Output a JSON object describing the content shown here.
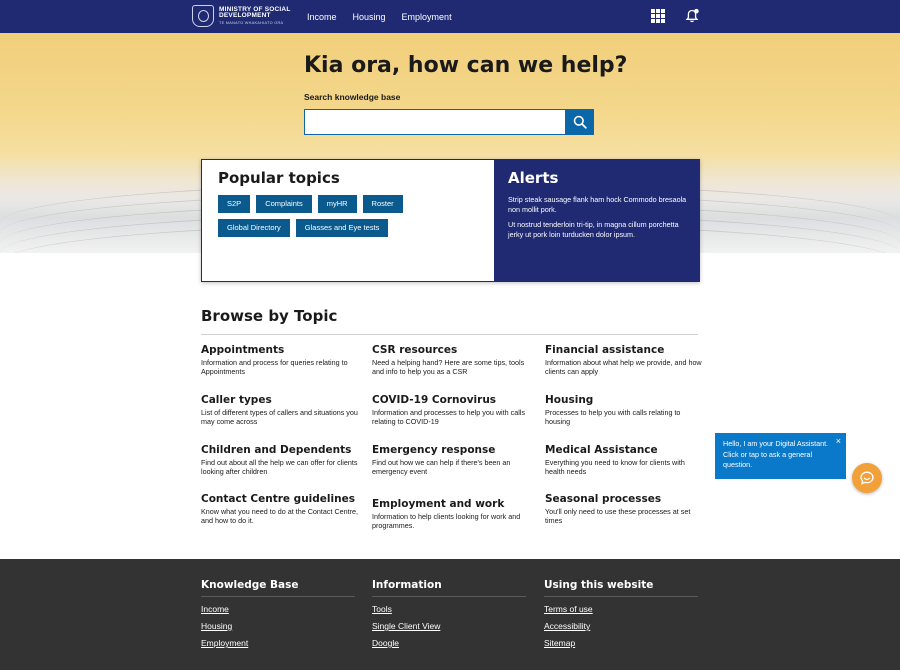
{
  "header": {
    "logo": {
      "line1": "MINISTRY OF SOCIAL",
      "line2": "DEVELOPMENT",
      "line3": "TE MANATŪ WHAKAHIATO ORA"
    },
    "nav": [
      "Income",
      "Housing",
      "Employment"
    ],
    "icons": [
      "apps-grid-icon",
      "notification-bell-icon"
    ]
  },
  "hero": {
    "title": "Kia ora, how can we help?",
    "search_label": "Search knowledge base",
    "search_value": "",
    "search_placeholder": ""
  },
  "popular_topics": {
    "title": "Popular topics",
    "rows": [
      [
        "S2P",
        "Complaints",
        "myHR",
        "Roster"
      ],
      [
        "Global Directory",
        "Glasses and Eye tests"
      ]
    ]
  },
  "alerts": {
    "title": "Alerts",
    "paragraphs": [
      "Strip steak sausage flank ham hock Commodo bresaola non mollit pork.",
      "Ut nostrud tenderloin tri-tip, in magna cillum porchetta jerky ut pork loin turducken dolor ipsum."
    ]
  },
  "browse": {
    "title": "Browse by Topic",
    "topics": [
      {
        "title": "Appointments",
        "desc": "Information and process for queries relating to Appointments"
      },
      {
        "title": "CSR resources",
        "desc": "Need a helping hand? Here are some tips, tools and info to help you as a CSR"
      },
      {
        "title": "Financial assistance",
        "desc": "Information about what help we provide, and how clients can apply"
      },
      {
        "title": "Caller types",
        "desc": "List of different types of callers and situations you may come across"
      },
      {
        "title": "COVID-19 Cornovirus",
        "desc": "Information and processes to help you with calls relating to COVID-19"
      },
      {
        "title": "Housing",
        "desc": "Processes to help you with calls relating to housing"
      },
      {
        "title": "Children and Dependents",
        "desc": "Find out about all the help we can offer for clients looking after children"
      },
      {
        "title": "Emergency response",
        "desc": "Find out how we can help if there's been an emergency event"
      },
      {
        "title": "Medical Assistance",
        "desc": "Everything you need to know for clients with health needs"
      },
      {
        "title": "Contact Centre guidelines",
        "desc": "Know what you need to do at the Contact Centre, and how to do it."
      },
      {
        "title": "Employment and work",
        "desc": "Information to help clients looking for work and programmes."
      },
      {
        "title": "Seasonal processes",
        "desc": "You'll only need to use these processes at set times"
      }
    ]
  },
  "chat": {
    "message": "Hello, I am your Digital Assistant. Click or tap to ask a general question.",
    "close_label": "×"
  },
  "footer": {
    "columns": [
      {
        "title": "Knowledge Base",
        "links": [
          "Income",
          "Housing",
          "Employment"
        ]
      },
      {
        "title": "Information",
        "links": [
          "Tools",
          "Single Client View",
          "Doogle"
        ]
      },
      {
        "title": "Using this website",
        "links": [
          "Terms of use",
          "Accessibility",
          "Sitemap"
        ]
      }
    ]
  },
  "colors": {
    "header_bg": "#1f2a73",
    "accent_blue": "#0b67a8",
    "chip_bg": "#0b5a8e",
    "alerts_bg": "#1f2a73",
    "chat_bg": "#0b79c9",
    "chat_fab": "#f2a039",
    "footer_bg": "#333333"
  }
}
